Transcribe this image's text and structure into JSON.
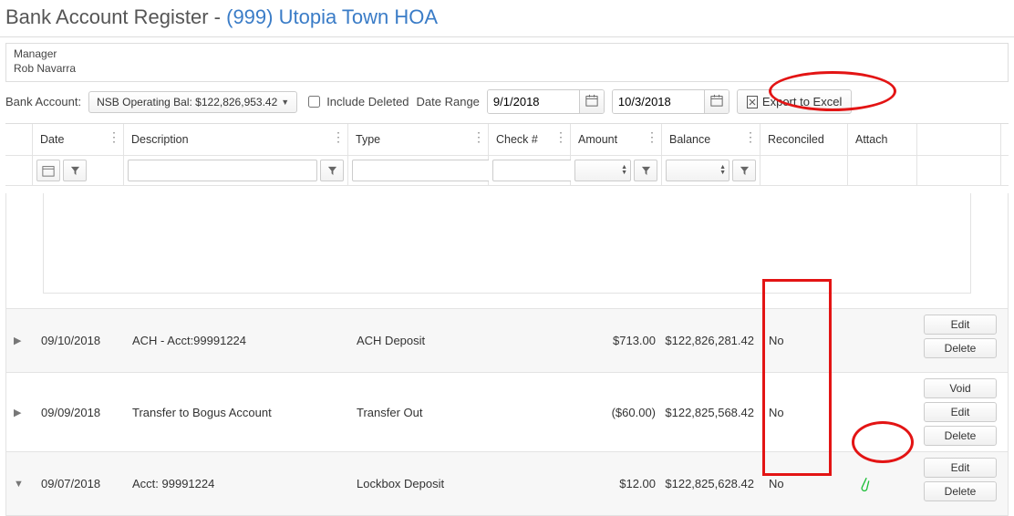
{
  "title_prefix": "Bank Account Register - ",
  "hoa_name": "(999) Utopia Town HOA",
  "manager_label": "Manager",
  "manager_name": "Rob Navarra",
  "filters": {
    "bank_account_label": "Bank Account:",
    "bank_account_value": "NSB Operating Bal: $122,826,953.42",
    "include_deleted_label": "Include Deleted",
    "date_range_label": "Date Range",
    "date_from": "9/1/2018",
    "date_to": "10/3/2018",
    "export_label": "Export to Excel"
  },
  "columns": {
    "date": "Date",
    "description": "Description",
    "type": "Type",
    "check": "Check #",
    "amount": "Amount",
    "balance": "Balance",
    "reconciled": "Reconciled",
    "attach": "Attach"
  },
  "rows": [
    {
      "date": "09/10/2018",
      "description": "ACH - Acct:99991224",
      "type": "ACH Deposit",
      "check": "",
      "amount": "$713.00",
      "balance": "$122,826,281.42",
      "reconciled": "No",
      "attach": false,
      "actions": [
        "Edit",
        "Delete"
      ]
    },
    {
      "date": "09/09/2018",
      "description": "Transfer to Bogus Account",
      "type": "Transfer Out",
      "check": "",
      "amount": "($60.00)",
      "balance": "$122,825,568.42",
      "reconciled": "No",
      "attach": false,
      "actions": [
        "Void",
        "Edit",
        "Delete"
      ]
    },
    {
      "date": "09/07/2018",
      "description": "Acct: 99991224",
      "type": "Lockbox Deposit",
      "check": "",
      "amount": "$12.00",
      "balance": "$122,825,628.42",
      "reconciled": "No",
      "attach": true,
      "actions": [
        "Edit",
        "Delete"
      ]
    }
  ],
  "action_labels": {
    "edit": "Edit",
    "delete": "Delete",
    "void": "Void"
  }
}
